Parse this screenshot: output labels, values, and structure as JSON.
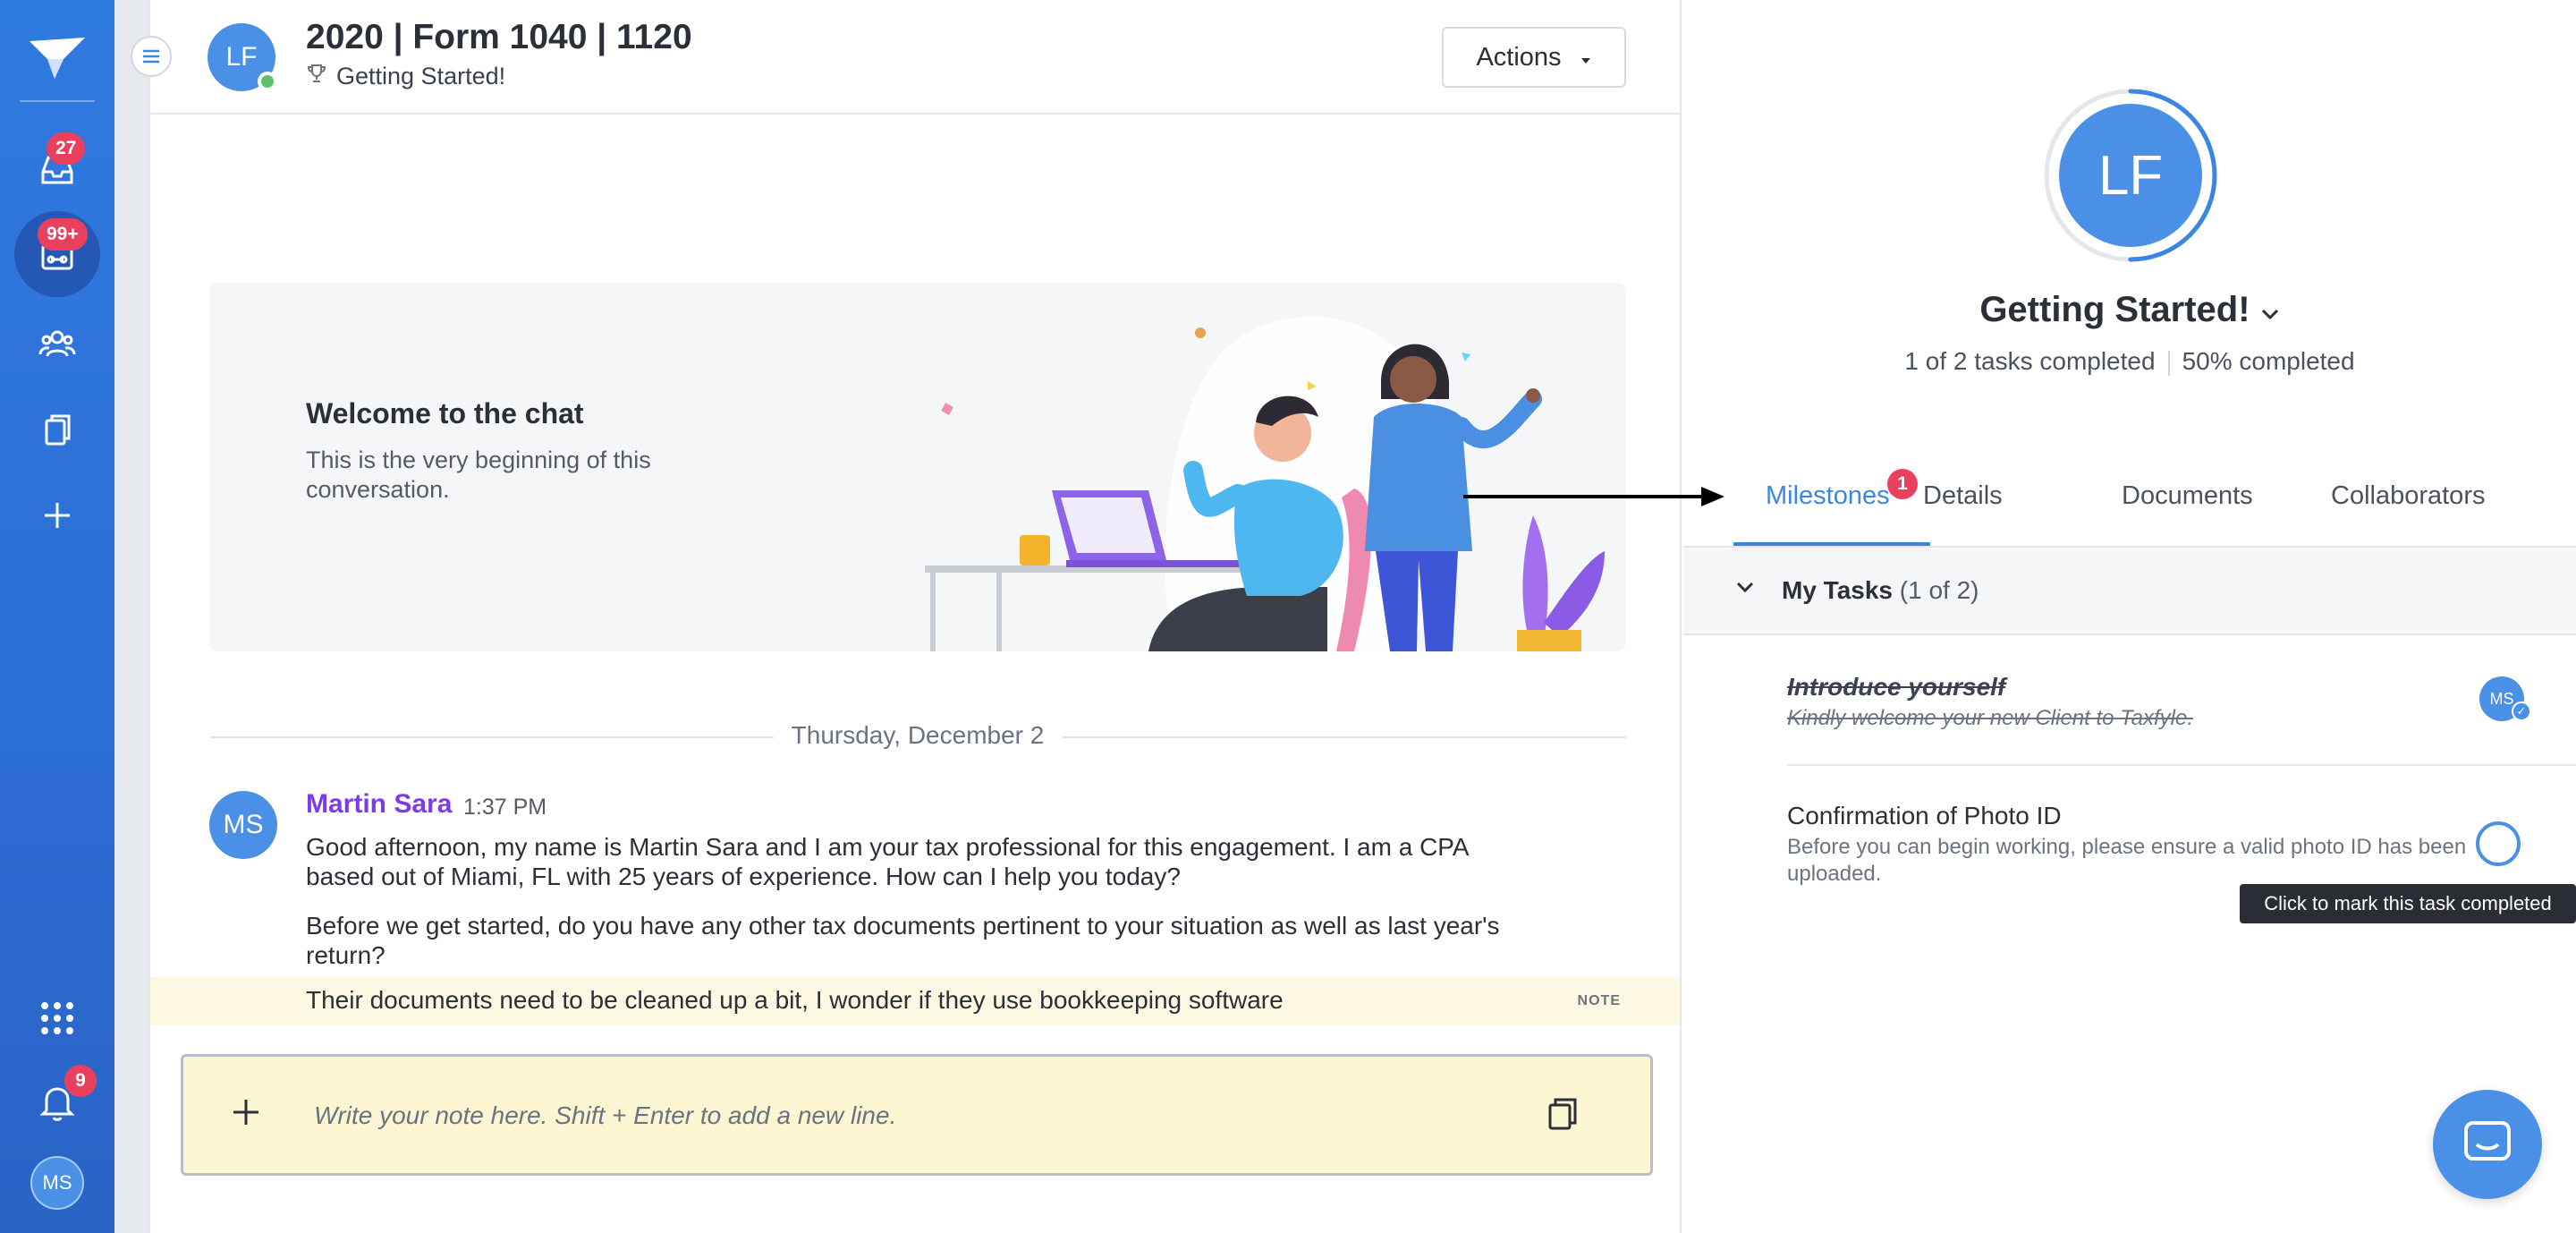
{
  "nav": {
    "inbox_badge": "27",
    "workspace_badge": "99+",
    "notifications_badge": "9",
    "user_initials": "MS",
    "icons": [
      "logo-icon",
      "inbox-icon",
      "workspace-icon",
      "team-icon",
      "documents-icon",
      "add-icon",
      "apps-grid-icon",
      "bell-icon"
    ]
  },
  "header": {
    "avatar_initials": "LF",
    "title": "2020 | Form 1040 | 1120",
    "subtitle": "Getting Started!",
    "actions_label": "Actions"
  },
  "welcome": {
    "title": "Welcome to the chat",
    "text": "This is the very beginning of this conversation."
  },
  "date_separator": "Thursday, December 2",
  "message": {
    "avatar_initials": "MS",
    "author": "Martin Sara",
    "time": "1:37 PM",
    "paragraphs": [
      "Good afternoon, my name is Martin Sara and I am your tax professional for this engagement. I am a CPA based out of Miami, FL with 25 years of experience. How can I help you today?",
      "Before we get started, do you have any other tax documents pertinent to your situation as well as last year's return?"
    ]
  },
  "note": {
    "text": "Their documents need to be cleaned up a bit, I wonder if they use bookkeeping software",
    "tag": "NOTE"
  },
  "composer": {
    "placeholder": "Write your note here. Shift + Enter to add a new line."
  },
  "panel": {
    "avatar_initials": "LF",
    "progress": 0.5,
    "title": "Getting Started!",
    "tasks_completed": "1 of 2 tasks completed",
    "percent_completed": "50% completed",
    "tabs": [
      {
        "label": "Milestones",
        "badge": "1",
        "active": true
      },
      {
        "label": "Details"
      },
      {
        "label": "Documents"
      },
      {
        "label": "Collaborators"
      }
    ],
    "tasks_header": {
      "title": "My Tasks",
      "count": "(1 of 2)"
    },
    "tasks": [
      {
        "title": "Introduce yourself",
        "desc": "Kindly welcome your new Client to Taxfyle.",
        "done": true,
        "assignee": "MS"
      },
      {
        "title": "Confirmation of Photo ID",
        "desc": "Before you can begin working, please ensure a valid photo ID has been uploaded.",
        "done": false
      }
    ],
    "tooltip": "Click to mark this task completed"
  },
  "colors": {
    "rail": "#2c6fd6",
    "accent": "#3a86e0",
    "badge": "#e9415d",
    "author": "#7c3aed",
    "note_bg": "#fdf8e1",
    "composer_bg": "#fdf6d3"
  }
}
